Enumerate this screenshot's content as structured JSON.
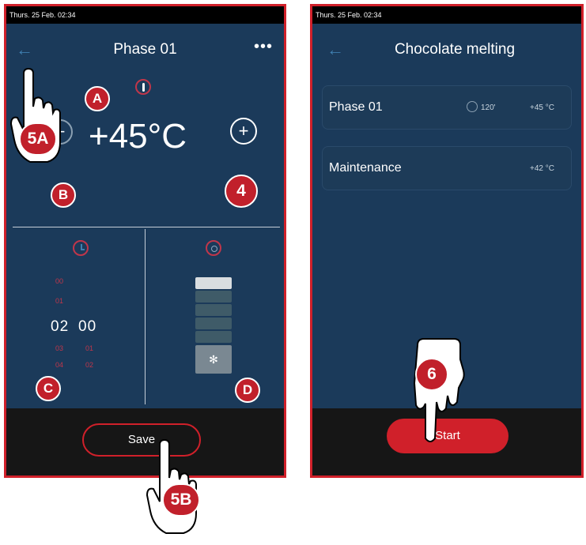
{
  "left_screen": {
    "status_time": "Thurs. 25 Feb. 02:34",
    "title": "Phase 01",
    "more_label": "•••",
    "temperature": "+45°C",
    "plus_label": "+",
    "timer": {
      "hours": "02",
      "minutes": "00",
      "hours_above": [
        "00",
        "01"
      ],
      "hours_below": [
        "03",
        "04"
      ],
      "minutes_below": [
        "01",
        "02"
      ]
    },
    "fan_level": 0.2,
    "save_label": "Save"
  },
  "right_screen": {
    "status_time": "Thurs. 25 Feb. 02:34",
    "title": "Chocolate melting",
    "phases": [
      {
        "label": "Phase 01",
        "time": "120'",
        "temp": "+45 °C"
      },
      {
        "label": "Maintenance",
        "temp": "+42 °C"
      }
    ],
    "start_label": "Start"
  },
  "callouts": {
    "a": "A",
    "b": "B",
    "c": "C",
    "d": "D",
    "four": "4",
    "five_a": "5A",
    "five_b": "5B",
    "six": "6"
  },
  "colors": {
    "screen_bg": "#1b3a5a",
    "accent_red": "#d0202a",
    "bottom_bar": "#161616"
  }
}
